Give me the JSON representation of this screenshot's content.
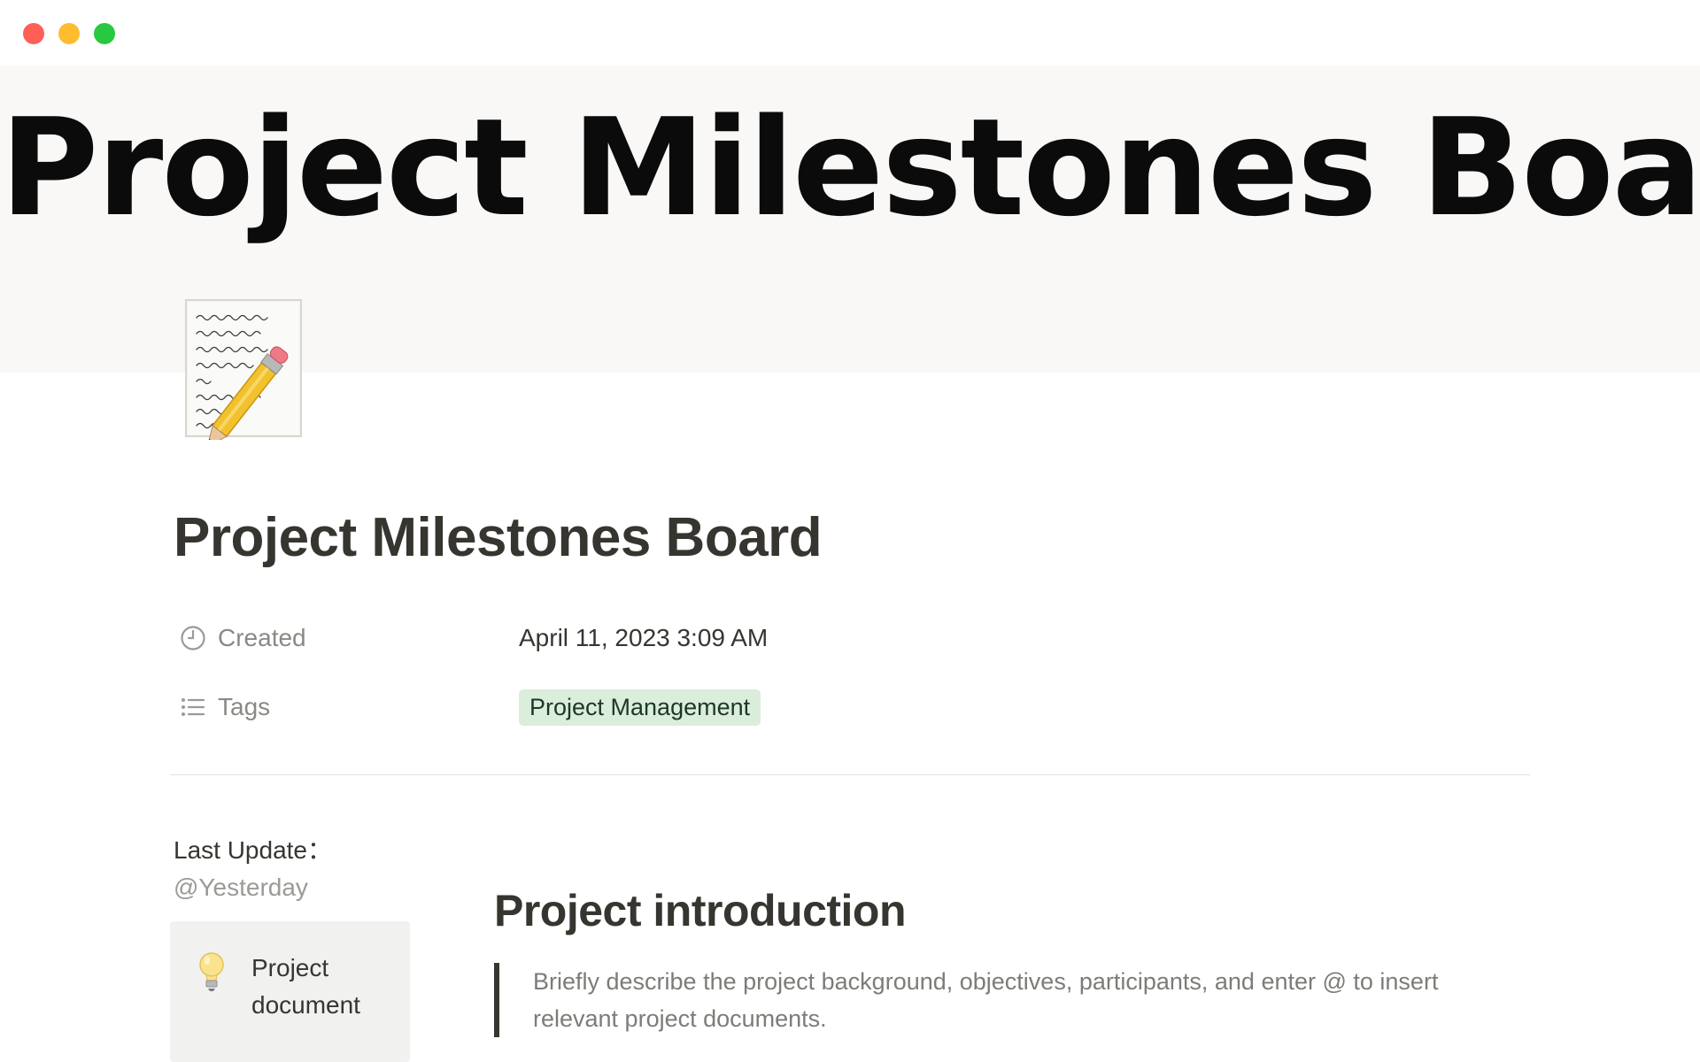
{
  "window": {
    "controls": [
      "close",
      "minimize",
      "maximize"
    ]
  },
  "cover": {
    "title": "Project Milestones Board"
  },
  "page": {
    "icon": "memo-pencil-icon",
    "title": "Project Milestones Board"
  },
  "properties": [
    {
      "icon": "clock-icon",
      "label": "Created",
      "value": "April 11, 2023 3:09 AM"
    },
    {
      "icon": "list-icon",
      "label": "Tags",
      "value": "Project Management"
    }
  ],
  "tag_colors": {
    "project_management_bg": "#dbeddb",
    "project_management_fg": "#1c3829"
  },
  "sidebar": {
    "last_update_label": "Last Update：",
    "last_update_value": "@Yesterday",
    "callout": {
      "icon": "lightbulb-icon",
      "text": "Project document"
    }
  },
  "content": {
    "heading": "Project introduction",
    "quote": "Briefly describe the project background, objectives, participants, and enter @ to insert relevant project documents."
  }
}
